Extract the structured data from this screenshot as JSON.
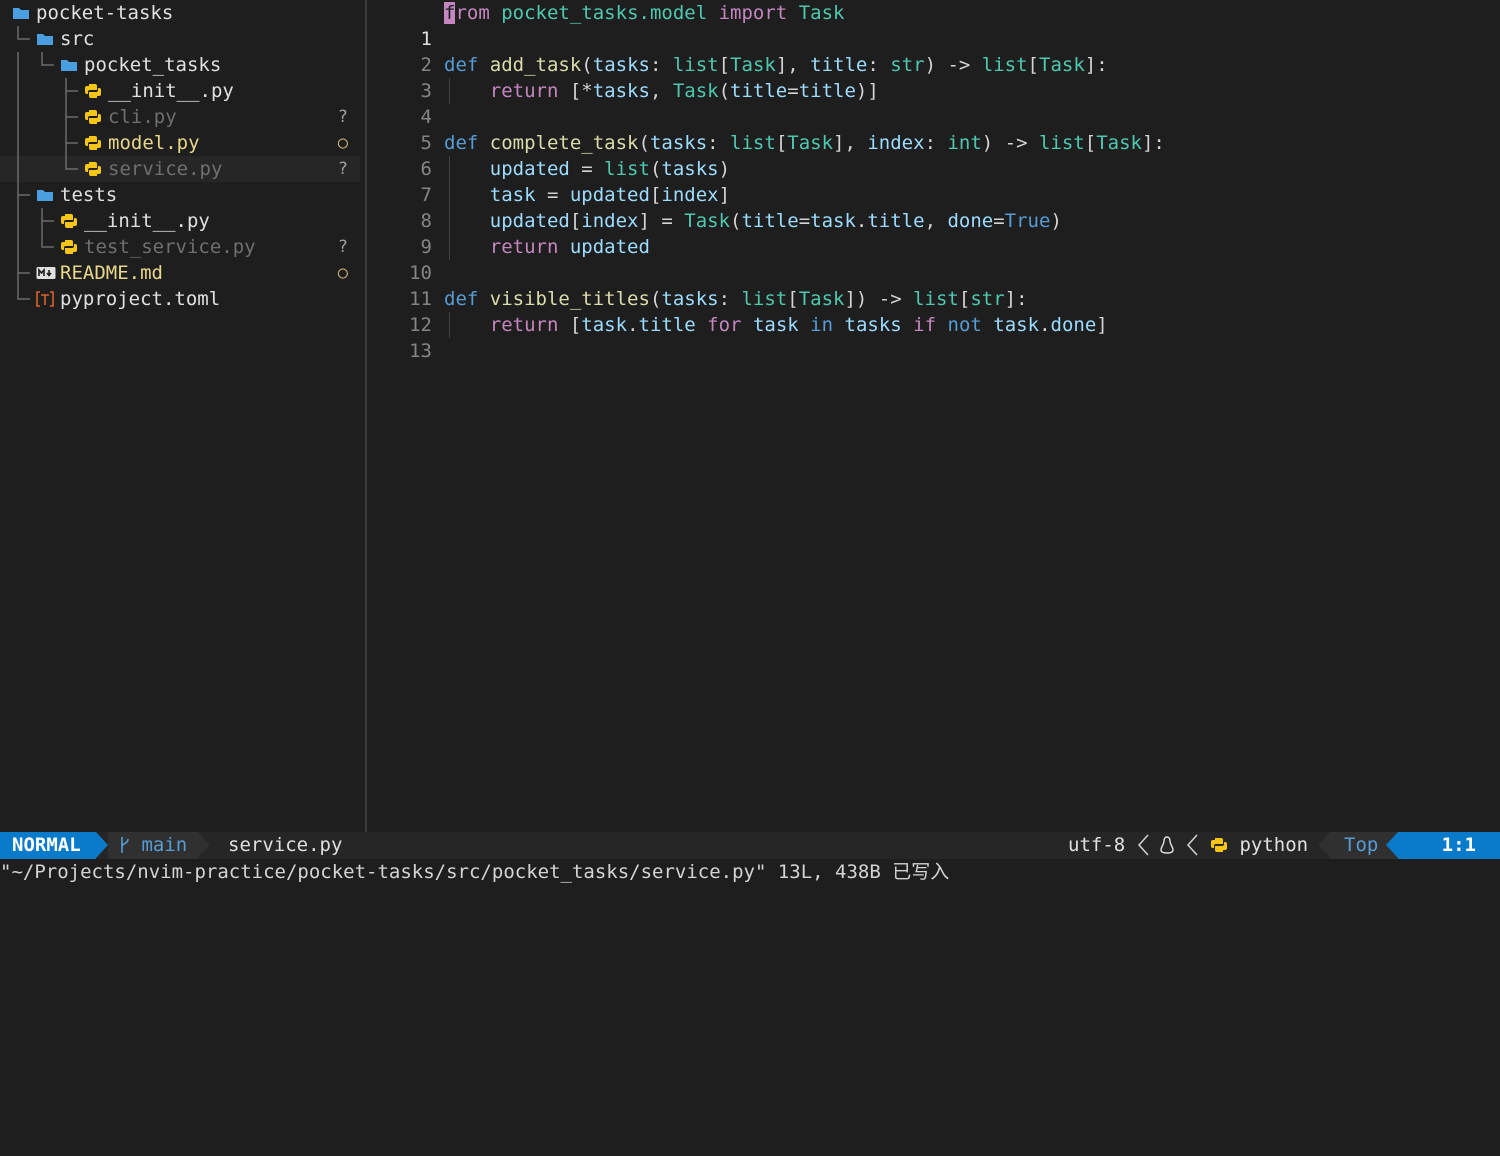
{
  "tree": {
    "root": "pocket-tasks",
    "items": [
      {
        "name": "pocket-tasks",
        "kind": "folder",
        "status": ""
      },
      {
        "name": "src",
        "kind": "folder",
        "status": ""
      },
      {
        "name": "pocket_tasks",
        "kind": "folder",
        "status": ""
      },
      {
        "name": "__init__.py",
        "kind": "python",
        "status": ""
      },
      {
        "name": "cli.py",
        "kind": "python",
        "status": "?"
      },
      {
        "name": "model.py",
        "kind": "python",
        "status": "○"
      },
      {
        "name": "service.py",
        "kind": "python",
        "status": "?"
      },
      {
        "name": "tests",
        "kind": "folder",
        "status": ""
      },
      {
        "name": "__init__.py",
        "kind": "python",
        "status": ""
      },
      {
        "name": "test_service.py",
        "kind": "python",
        "status": "?"
      },
      {
        "name": "README.md",
        "kind": "markdown",
        "status": "○"
      },
      {
        "name": "pyproject.toml",
        "kind": "toml",
        "status": ""
      }
    ]
  },
  "editor": {
    "line_numbers": [
      "1",
      "2",
      "3",
      "4",
      "5",
      "6",
      "7",
      "8",
      "9",
      "10",
      "11",
      "12",
      "13"
    ]
  },
  "statusline": {
    "mode": "NORMAL",
    "branch_icon": "git-branch-icon",
    "branch": "main",
    "filename": "service.py",
    "encoding": "utf-8",
    "os_icon": "linux-icon",
    "filetype": "python",
    "position": "Top",
    "line_col": "1:1"
  },
  "cmdline": {
    "message": "\"~/Projects/nvim-practice/pocket-tasks/src/pocket_tasks/service.py\" 13L, 438B 已写入"
  },
  "colors": {
    "accent": "#0a7aca",
    "keyword": "#569cd6",
    "function": "#dcdcaa",
    "type": "#4ec9b0",
    "variable": "#9cdcfe",
    "import": "#c586c0",
    "folder": "#4a9fe0",
    "python_icon": "#f5c518"
  }
}
